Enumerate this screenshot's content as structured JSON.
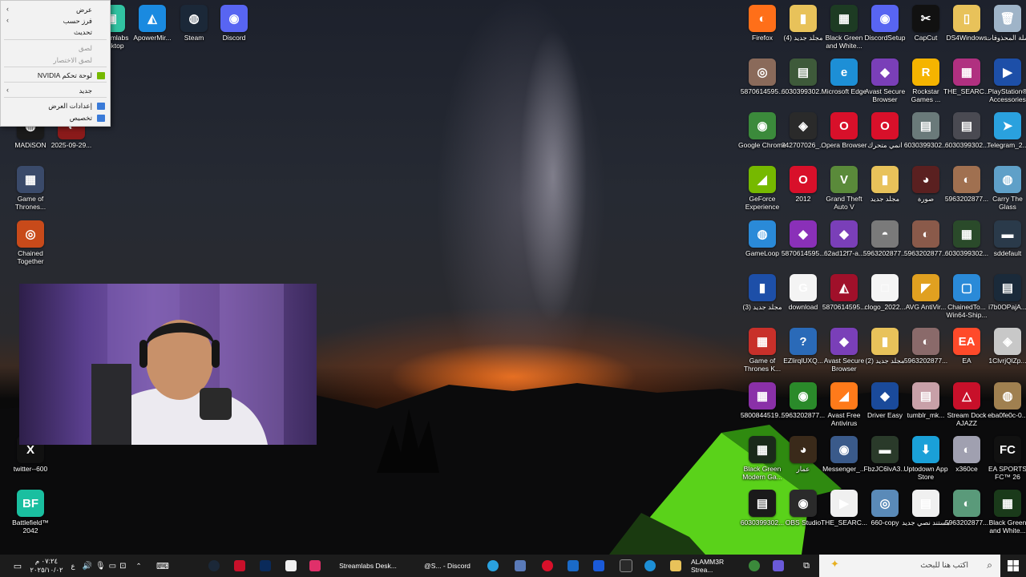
{
  "desktop_icons": [
    {
      "name": "icon-recycle-bin",
      "label": "سلة المحذوفات",
      "glyph": "🗑",
      "color": "#9fb4c8"
    },
    {
      "name": "icon-ds4windows",
      "label": "DS4Windows",
      "glyph": "▯",
      "color": "#e8c25a"
    },
    {
      "name": "icon-capcut",
      "label": "CapCut",
      "glyph": "✂",
      "color": "#111111"
    },
    {
      "name": "icon-discordsetup",
      "label": "DiscordSetup",
      "glyph": "◉",
      "color": "#5865f2"
    },
    {
      "name": "icon-black-green-1",
      "label": "Black Green and White...",
      "glyph": "▦",
      "color": "#1d3b23"
    },
    {
      "name": "icon-new-folder-4",
      "label": "مجلد جديد (4)",
      "glyph": "▮",
      "color": "#e8c25a"
    },
    {
      "name": "icon-firefox",
      "label": "Firefox",
      "glyph": "◐",
      "color": "#ff6f19"
    },
    {
      "name": "icon-playstation-accessories",
      "label": "PlayStation® Accessories",
      "glyph": "▶",
      "color": "#1d4fa8"
    },
    {
      "name": "icon-the-search-1",
      "label": "THE_SEARC...",
      "glyph": "▦",
      "color": "#b03080"
    },
    {
      "name": "icon-rockstar",
      "label": "Rockstar Games ...",
      "glyph": "R",
      "color": "#f5b400"
    },
    {
      "name": "icon-avast-browser-1",
      "label": "Avast Secure Browser",
      "glyph": "◆",
      "color": "#7a3fb8"
    },
    {
      "name": "icon-edge",
      "label": "Microsoft Edge",
      "glyph": "e",
      "color": "#1d8fd6"
    },
    {
      "name": "icon-file-6030-1",
      "label": "6030399302...",
      "glyph": "▤",
      "color": "#3e5a3a"
    },
    {
      "name": "icon-file-5870-1",
      "label": "5870614595...",
      "glyph": "◎",
      "color": "#8a6a5a"
    },
    {
      "name": "icon-telegram-1",
      "label": "Telegram_2...",
      "glyph": "➤",
      "color": "#2aa1de"
    },
    {
      "name": "icon-file-6030-2",
      "label": "6030399302...",
      "glyph": "▤",
      "color": "#4a4a52"
    },
    {
      "name": "icon-file-6030-3",
      "label": "6030399302...",
      "glyph": "▤",
      "color": "#6a7a7a"
    },
    {
      "name": "icon-opera-gx",
      "label": "انمي متحرك",
      "glyph": "O",
      "color": "#d8102a"
    },
    {
      "name": "icon-opera-browser",
      "label": "Opera Browser",
      "glyph": "O",
      "color": "#d8102a"
    },
    {
      "name": "icon-file-3427",
      "label": "342707026_...",
      "glyph": "◈",
      "color": "#2a2a2a"
    },
    {
      "name": "icon-chrome",
      "label": "Google Chrome",
      "glyph": "◉",
      "color": "#3b8a3b"
    },
    {
      "name": "icon-carry-glass",
      "label": "Carry The Glass",
      "glyph": "◍",
      "color": "#5fa0c8"
    },
    {
      "name": "icon-file-5963-1",
      "label": "5963202877...",
      "glyph": "◐",
      "color": "#a07050"
    },
    {
      "name": "icon-image",
      "label": "صورة",
      "glyph": "◕",
      "color": "#5a2020"
    },
    {
      "name": "icon-new-folder",
      "label": "مجلد جديد",
      "glyph": "▮",
      "color": "#e8c25a"
    },
    {
      "name": "icon-gta5",
      "label": "Grand Theft Auto V",
      "glyph": "V",
      "color": "#5a8a3a"
    },
    {
      "name": "icon-2012",
      "label": "2012",
      "glyph": "O",
      "color": "#d8102a"
    },
    {
      "name": "icon-geforce",
      "label": "GeForce Experience",
      "glyph": "◢",
      "color": "#76b900"
    },
    {
      "name": "icon-sddefault",
      "label": "sddefault",
      "glyph": "▬",
      "color": "#2a3a4a"
    },
    {
      "name": "icon-file-6030-4",
      "label": "6030399302...",
      "glyph": "▦",
      "color": "#2a4a2a"
    },
    {
      "name": "icon-file-5963-2",
      "label": "5963202877...",
      "glyph": "◐",
      "color": "#8a5a4a"
    },
    {
      "name": "icon-file-5963-3",
      "label": "5963202877...",
      "glyph": "◓",
      "color": "#7a7a7a"
    },
    {
      "name": "icon-file-62ad",
      "label": "62ad12f7-a...",
      "glyph": "◆",
      "color": "#7a3fb8"
    },
    {
      "name": "icon-file-5870-2",
      "label": "5870614595...",
      "glyph": "◆",
      "color": "#8a30b8"
    },
    {
      "name": "icon-gameloop",
      "label": "GameLoop",
      "glyph": "◍",
      "color": "#2a8ad8"
    },
    {
      "name": "icon-i7b0",
      "label": "i7b0OPajA...",
      "glyph": "▤",
      "color": "#1a2a3a"
    },
    {
      "name": "icon-chainedto",
      "label": "ChainedTo... Win64-Ship...",
      "glyph": "▢",
      "color": "#2a8ad8"
    },
    {
      "name": "icon-avg",
      "label": "AVG AntiVir...",
      "glyph": "◤",
      "color": "#e0a020"
    },
    {
      "name": "icon-clogo",
      "label": "clogo_2022...",
      "glyph": "□",
      "color": "#f5f5f5"
    },
    {
      "name": "icon-file-5870-3",
      "label": "5870614595...",
      "glyph": "◭",
      "color": "#a0102a"
    },
    {
      "name": "icon-google-download",
      "label": "download",
      "glyph": "G",
      "color": "#f4f4f4"
    },
    {
      "name": "icon-new-folder-3",
      "label": "مجلد جديد (3)",
      "glyph": "▮",
      "color": "#1d4fa8"
    },
    {
      "name": "icon-1clvrj",
      "label": "1ClvrjQlZp...",
      "glyph": "◈",
      "color": "#c8c8c8"
    },
    {
      "name": "icon-ea",
      "label": "EA",
      "glyph": "EA",
      "color": "#ff4a2a"
    },
    {
      "name": "icon-file-5963-4",
      "label": "5963202877...",
      "glyph": "◐",
      "color": "#8a6a6a"
    },
    {
      "name": "icon-new-folder-2",
      "label": "مجلد جديد (2)",
      "glyph": "▮",
      "color": "#e8c25a"
    },
    {
      "name": "icon-avast-browser-2",
      "label": "Avast Secure Browser",
      "glyph": "◆",
      "color": "#7a3fb8"
    },
    {
      "name": "icon-ezliirq",
      "label": "EZlirqlUXQ...",
      "glyph": "?",
      "color": "#2a6ab8"
    },
    {
      "name": "icon-got-kingsroad",
      "label": "Game of Thrones K...",
      "glyph": "▦",
      "color": "#c8302a"
    },
    {
      "name": "icon-eba0",
      "label": "eba0fe0c-0...",
      "glyph": "◍",
      "color": "#a08050"
    },
    {
      "name": "icon-streamdock",
      "label": "Stream Dock AJAZZ",
      "glyph": "△",
      "color": "#c8102a"
    },
    {
      "name": "icon-tumblr",
      "label": "tumblr_mk...",
      "glyph": "▤",
      "color": "#c8a0a8"
    },
    {
      "name": "icon-driver-easy",
      "label": "Driver Easy",
      "glyph": "◆",
      "color": "#1a4a9a"
    },
    {
      "name": "icon-avast-free",
      "label": "Avast Free Antivirus",
      "glyph": "◢",
      "color": "#ff7a1a"
    },
    {
      "name": "icon-file-5963-5",
      "label": "5963202877...",
      "glyph": "◉",
      "color": "#2a8a2a"
    },
    {
      "name": "icon-file-5800",
      "label": "5800844519...",
      "glyph": "▦",
      "color": "#8a30a8"
    },
    {
      "name": "icon-ea-fc26",
      "label": "EA SPORTS FC™ 26",
      "glyph": "FC",
      "color": "#111111"
    },
    {
      "name": "icon-x360ce",
      "label": "x360ce",
      "glyph": "◐",
      "color": "#a0a0b0"
    },
    {
      "name": "icon-uptodown",
      "label": "Uptodown App Store",
      "glyph": "⬇",
      "color": "#1aa0d8"
    },
    {
      "name": "icon-fbzjc",
      "label": "FbzJC6lvA3...",
      "glyph": "▬",
      "color": "#2a3a2a"
    },
    {
      "name": "icon-messenger",
      "label": "Messenger_...",
      "glyph": "◉",
      "color": "#3a5a8a"
    },
    {
      "name": "icon-ammar",
      "label": "عمار",
      "glyph": "◕",
      "color": "#3a2a1a"
    },
    {
      "name": "icon-black-green-modern",
      "label": "Black Green Modern Ga...",
      "glyph": "▦",
      "color": "#1a2a1a"
    },
    {
      "name": "icon-black-green-2",
      "label": "Black Green and White...",
      "glyph": "▦",
      "color": "#1a3a1a"
    },
    {
      "name": "icon-file-5963-6",
      "label": "5963202877...",
      "glyph": "◐",
      "color": "#5a9a7a"
    },
    {
      "name": "icon-text-doc",
      "label": "مستند نصي جديد",
      "glyph": "▤",
      "color": "#f0f0f0"
    },
    {
      "name": "icon-660-copy",
      "label": "660-copy",
      "glyph": "◎",
      "color": "#5a8ab8"
    },
    {
      "name": "icon-the-search-2",
      "label": "THE_SEARC...",
      "glyph": "▶",
      "color": "#f0f0f0"
    },
    {
      "name": "icon-obs",
      "label": "OBS Studio",
      "glyph": "◉",
      "color": "#2a2a2a"
    },
    {
      "name": "icon-file-6030-5",
      "label": "6030399302...",
      "glyph": "▤",
      "color": "#1a1a1a"
    },
    {
      "name": "icon-telegram-download",
      "label": "download",
      "glyph": "➤",
      "color": "#2aa1de"
    },
    {
      "name": "icon-streamlabs",
      "label": "Streamlabs Desktop",
      "glyph": "▣",
      "color": "#31c3a2"
    },
    {
      "name": "icon-apowermirror",
      "label": "ApowerMir...",
      "glyph": "◭",
      "color": "#1a8ae0"
    },
    {
      "name": "icon-steam",
      "label": "Steam",
      "glyph": "◍",
      "color": "#1b2838"
    },
    {
      "name": "icon-discord",
      "label": "Discord",
      "glyph": "◉",
      "color": "#5865f2"
    },
    {
      "name": "icon-madison",
      "label": "MADiSON",
      "glyph": "◍",
      "color": "#1a1a1a"
    },
    {
      "name": "icon-file-2025",
      "label": "2025-09-29...",
      "glyph": "◐",
      "color": "#8a1a1a"
    },
    {
      "name": "icon-got",
      "label": "Game of Thrones...",
      "glyph": "▦",
      "color": "#3a4a6a"
    },
    {
      "name": "icon-chained-together",
      "label": "Chained Together",
      "glyph": "◎",
      "color": "#c84a1a"
    },
    {
      "name": "icon-twitter",
      "label": "twitter--600",
      "glyph": "X",
      "color": "#111111"
    },
    {
      "name": "icon-battlefield",
      "label": "Battlefield™ 2042",
      "glyph": "BF",
      "color": "#1abfa0"
    }
  ],
  "context_menu": {
    "items": [
      {
        "label": "عرض",
        "disabled": false,
        "submenu": true
      },
      {
        "label": "فرز حسب",
        "disabled": false,
        "submenu": true
      },
      {
        "label": "تحديث",
        "disabled": false,
        "submenu": false
      },
      {
        "label": "لصق",
        "disabled": true,
        "submenu": false
      },
      {
        "label": "لصق الاختصار",
        "disabled": true,
        "submenu": false
      },
      {
        "label": "لوحة تحكم NVIDIA",
        "disabled": false,
        "submenu": false,
        "icon_color": "#76b900"
      },
      {
        "label": "جديد",
        "disabled": false,
        "submenu": true
      },
      {
        "label": "إعدادات العرض",
        "disabled": false,
        "submenu": false,
        "icon_color": "#3a7ad8"
      },
      {
        "label": "تخصيص",
        "disabled": false,
        "submenu": false,
        "icon_color": "#3a7ad8"
      }
    ]
  },
  "webcam": {
    "description_free": ""
  },
  "taskbar": {
    "search_placeholder": "اكتب هنا للبحث",
    "streamlabs_label": "Streamlabs Desk...",
    "discord_label": "@S... - Discord",
    "stream_label": "ALAMM3R Strea...",
    "clock_time": "٠٧:٢٤ م",
    "clock_date": "٢٠٢٥/١٠/٠٢",
    "lang": "ع"
  },
  "colors": {
    "taskbar": "#1c1c1c",
    "menu_bg": "#f2f2f2",
    "accent": "#3a7ad8"
  }
}
